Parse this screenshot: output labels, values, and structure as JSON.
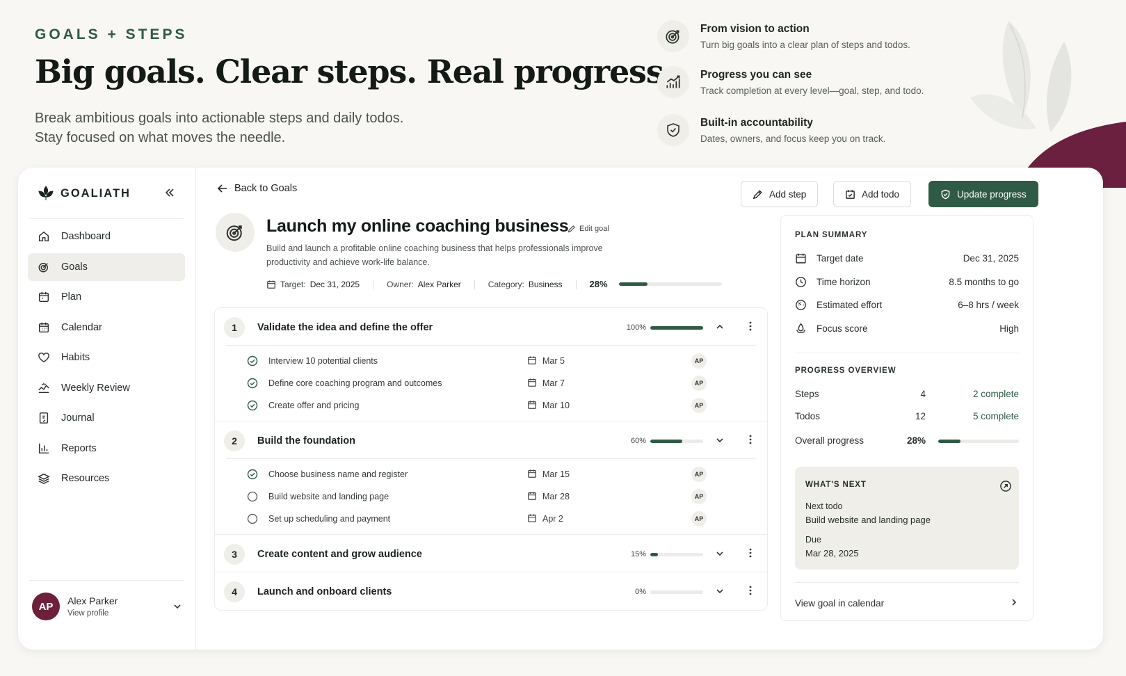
{
  "hero": {
    "eyebrow": "GOALS + STEPS",
    "headline": "Big goals. Clear steps. Real progress.",
    "sub1": "Break ambitious goals into actionable steps and daily todos.",
    "sub2": "Stay focused on what moves the needle.",
    "features": [
      {
        "title": "From vision to action",
        "desc": "Turn big goals into a clear plan of steps and todos.",
        "icon": "target-icon"
      },
      {
        "title": "Progress you can see",
        "desc": "Track completion at every level—goal, step, and todo.",
        "icon": "chart-icon"
      },
      {
        "title": "Built-in accountability",
        "desc": "Dates, owners, and focus keep you on track.",
        "icon": "shield-check-icon"
      }
    ]
  },
  "colors": {
    "accent": "#2f5a45",
    "brand_plum": "#6e1f3a",
    "background": "#f8f7f4"
  },
  "sidebar": {
    "logo": "GOALIATH",
    "items": [
      {
        "label": "Dashboard",
        "icon": "home-icon"
      },
      {
        "label": "Goals",
        "icon": "target-icon",
        "active": true
      },
      {
        "label": "Plan",
        "icon": "calendar-plan-icon"
      },
      {
        "label": "Calendar",
        "icon": "calendar-icon"
      },
      {
        "label": "Habits",
        "icon": "heart-icon"
      },
      {
        "label": "Weekly Review",
        "icon": "review-icon"
      },
      {
        "label": "Journal",
        "icon": "journal-icon"
      },
      {
        "label": "Reports",
        "icon": "reports-icon"
      },
      {
        "label": "Resources",
        "icon": "layers-icon"
      }
    ],
    "user": {
      "initials": "AP",
      "name": "Alex Parker",
      "link": "View profile"
    }
  },
  "toolbar": {
    "back": "Back to Goals",
    "add_step": "Add step",
    "add_todo": "Add todo",
    "update_progress": "Update progress"
  },
  "goal": {
    "title": "Launch my online coaching business",
    "edit": "Edit goal",
    "desc": "Build and launch a profitable online coaching business that helps professionals improve productivity and achieve work-life balance.",
    "target_label": "Target:",
    "target": "Dec 31, 2025",
    "owner_label": "Owner:",
    "owner": "Alex Parker",
    "category_label": "Category:",
    "category": "Business",
    "progress_text": "28%",
    "progress": 0.28
  },
  "steps": [
    {
      "num": "1",
      "title": "Validate the idea and define the offer",
      "pct": "100%",
      "progress": 1.0,
      "expanded": true,
      "todos": [
        {
          "title": "Interview 10 potential clients",
          "date": "Mar 5",
          "owner": "AP",
          "done": true
        },
        {
          "title": "Define core coaching program and outcomes",
          "date": "Mar 7",
          "owner": "AP",
          "done": true
        },
        {
          "title": "Create offer and pricing",
          "date": "Mar 10",
          "owner": "AP",
          "done": true
        }
      ]
    },
    {
      "num": "2",
      "title": "Build the foundation",
      "pct": "60%",
      "progress": 0.6,
      "expanded": true,
      "todos": [
        {
          "title": "Choose business name and register",
          "date": "Mar 15",
          "owner": "AP",
          "done": true
        },
        {
          "title": "Build website and landing page",
          "date": "Mar 28",
          "owner": "AP",
          "done": false
        },
        {
          "title": "Set up scheduling and payment",
          "date": "Apr 2",
          "owner": "AP",
          "done": false
        }
      ]
    },
    {
      "num": "3",
      "title": "Create content and grow audience",
      "pct": "15%",
      "progress": 0.15,
      "expanded": false,
      "todos": []
    },
    {
      "num": "4",
      "title": "Launch and onboard clients",
      "pct": "0%",
      "progress": 0.0,
      "expanded": false,
      "todos": []
    }
  ],
  "summary": {
    "heading": "PLAN SUMMARY",
    "rows": [
      {
        "label": "Target date",
        "value": "Dec 31, 2025",
        "icon": "calendar-icon"
      },
      {
        "label": "Time horizon",
        "value": "8.5 months to go",
        "icon": "clock-icon"
      },
      {
        "label": "Estimated effort",
        "value": "6–8 hrs / week",
        "icon": "effort-icon"
      },
      {
        "label": "Focus score",
        "value": "High",
        "icon": "focus-icon"
      }
    ]
  },
  "overview": {
    "heading": "PROGRESS OVERVIEW",
    "steps_label": "Steps",
    "steps_count": "4",
    "steps_complete": "2 complete",
    "todos_label": "Todos",
    "todos_count": "12",
    "todos_complete": "5 complete",
    "overall_label": "Overall progress",
    "overall_pct": "28%",
    "overall": 0.28
  },
  "next": {
    "heading": "WHAT'S NEXT",
    "todo_label": "Next todo",
    "todo": "Build website and landing page",
    "due_label": "Due",
    "due": "Mar 28, 2025"
  },
  "calendar_link": "View goal in calendar"
}
